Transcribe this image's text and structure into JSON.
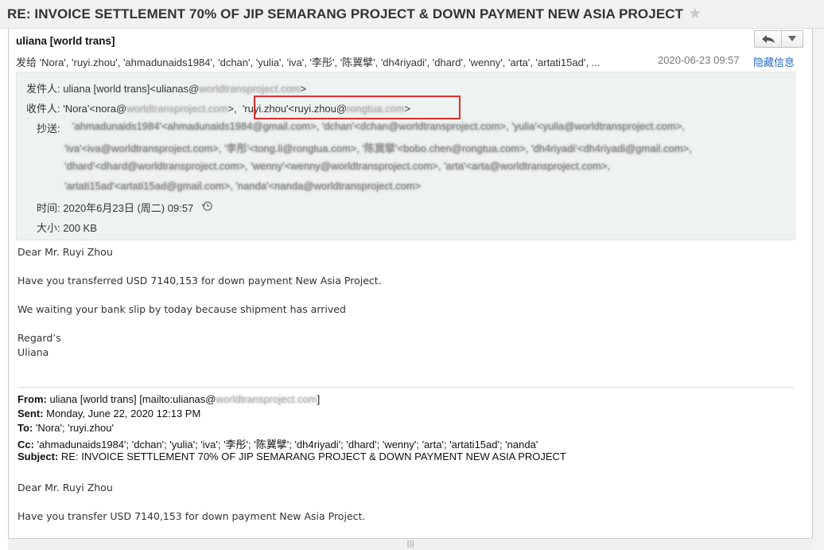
{
  "email": {
    "subject": "RE: INVOICE SETTLEMENT 70% OF JIP SEMARANG PROJECT & DOWN PAYMENT NEW ASIA PROJECT",
    "sender_name": "uliana [world trans]",
    "to_label": "发给",
    "to_list": "'Nora', 'ruyi.zhou', 'ahmadunaids1984', 'dchan', 'yulia', 'iva', '李彤', '陈冀擘', 'dh4riyadi', 'dhard', 'wenny', 'arta', 'artati15ad', ...",
    "date_short": "2020-06-23 09:57",
    "hide_details_label": "隐藏信息"
  },
  "header_details": {
    "from_label": "发件人:",
    "from_name": "uliana [world trans]",
    "from_email_prefix": "<ulianas@",
    "from_email_domain": "worldtransproject.com",
    "from_email_suffix": ">",
    "to_label": "收件人:",
    "to_nora_name": "'Nora'",
    "to_nora_prefix": "<nora@",
    "to_nora_domain": "worldtransproject.com",
    "to_nora_suffix": ">,",
    "to_ruyi_name": "'ruyi.zhou'",
    "to_ruyi_prefix": "<ruyi.zhou@",
    "to_ruyi_domain": "rongtua.com",
    "to_ruyi_suffix": ">",
    "cc_label": "抄送:",
    "cc_line1": "'ahmadunaids1984'<ahmadunaids1984@gmail.com>, 'dchan'<dchan@worldtransproject.com>, 'yulia'<yulia@worldtransproject.com>,",
    "cc_line2": "'iva'<iva@worldtransproject.com>, '李彤'<tong.li@rongtua.com>, '陈冀擘'<bobo.chen@rongtua.com>, 'dh4riyadi'<dh4riyadi@gmail.com>,",
    "cc_line3": "'dhard'<dhard@worldtransproject.com>, 'wenny'<wenny@worldtransproject.com>, 'arta'<arta@worldtransproject.com>,",
    "cc_line4": "'artati15ad'<artati15ad@gmail.com>, 'nanda'<nanda@worldtransproject.com>",
    "time_label": "时间:",
    "time_value": "2020年6月23日 (周二) 09:57",
    "size_label": "大小:",
    "size_value": "200 KB"
  },
  "body": {
    "greeting": "Dear Mr. Ruyi Zhou",
    "line1": "Have you transferred USD 7140,153 for down payment New Asia Project.",
    "line2": "We waiting your bank slip by today because shipment has arrived",
    "closing": "Regard’s",
    "signature": "Uliana"
  },
  "quoted": {
    "from_label": "From:",
    "from_value": "uliana [world trans] [mailto:ulianas@",
    "from_domain": "worldtransproject.com",
    "from_suffix": "]",
    "sent_label": "Sent:",
    "sent_value": "Monday, June 22, 2020 12:13 PM",
    "to_label": "To:",
    "to_value": "'Nora'; 'ruyi.zhou'",
    "cc_label": "Cc:",
    "cc_value": "'ahmadunaids1984'; 'dchan'; 'yulia'; 'iva'; '李彤'; '陈冀擘'; 'dh4riyadi'; 'dhard'; 'wenny'; 'arta'; 'artati15ad'; 'nanda'",
    "subject_label": "Subject:",
    "subject_value": "RE: INVOICE SETTLEMENT 70% OF JIP SEMARANG PROJECT & DOWN PAYMENT NEW ASIA PROJECT",
    "greeting": "Dear Mr. Ruyi Zhou",
    "line1": "Have you transfer USD 7140,153 for down payment New Asia Project."
  },
  "icons": {
    "star": "star-icon",
    "reply": "reply-icon",
    "dropdown": "chevron-down-icon",
    "clock": "clock-history-icon"
  }
}
